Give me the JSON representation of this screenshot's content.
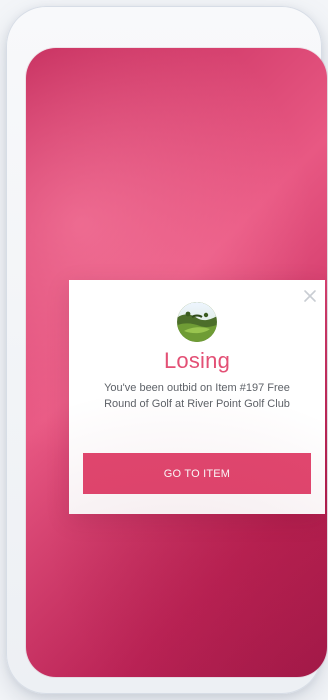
{
  "notification": {
    "status_title": "Losing",
    "message": "You've been outbid on Item #197 Free Round of Golf at River Point Golf Club",
    "cta_label": "GO TO ITEM"
  },
  "icons": {
    "close": "close-icon",
    "thumbnail": "golf-course-thumbnail"
  },
  "colors": {
    "background_primary": "#c22859",
    "background_highlight": "#e85883",
    "accent": "#e2476f",
    "status_title": "#e35075",
    "body_text": "#5e6268",
    "modal_background": "#ffffff"
  }
}
